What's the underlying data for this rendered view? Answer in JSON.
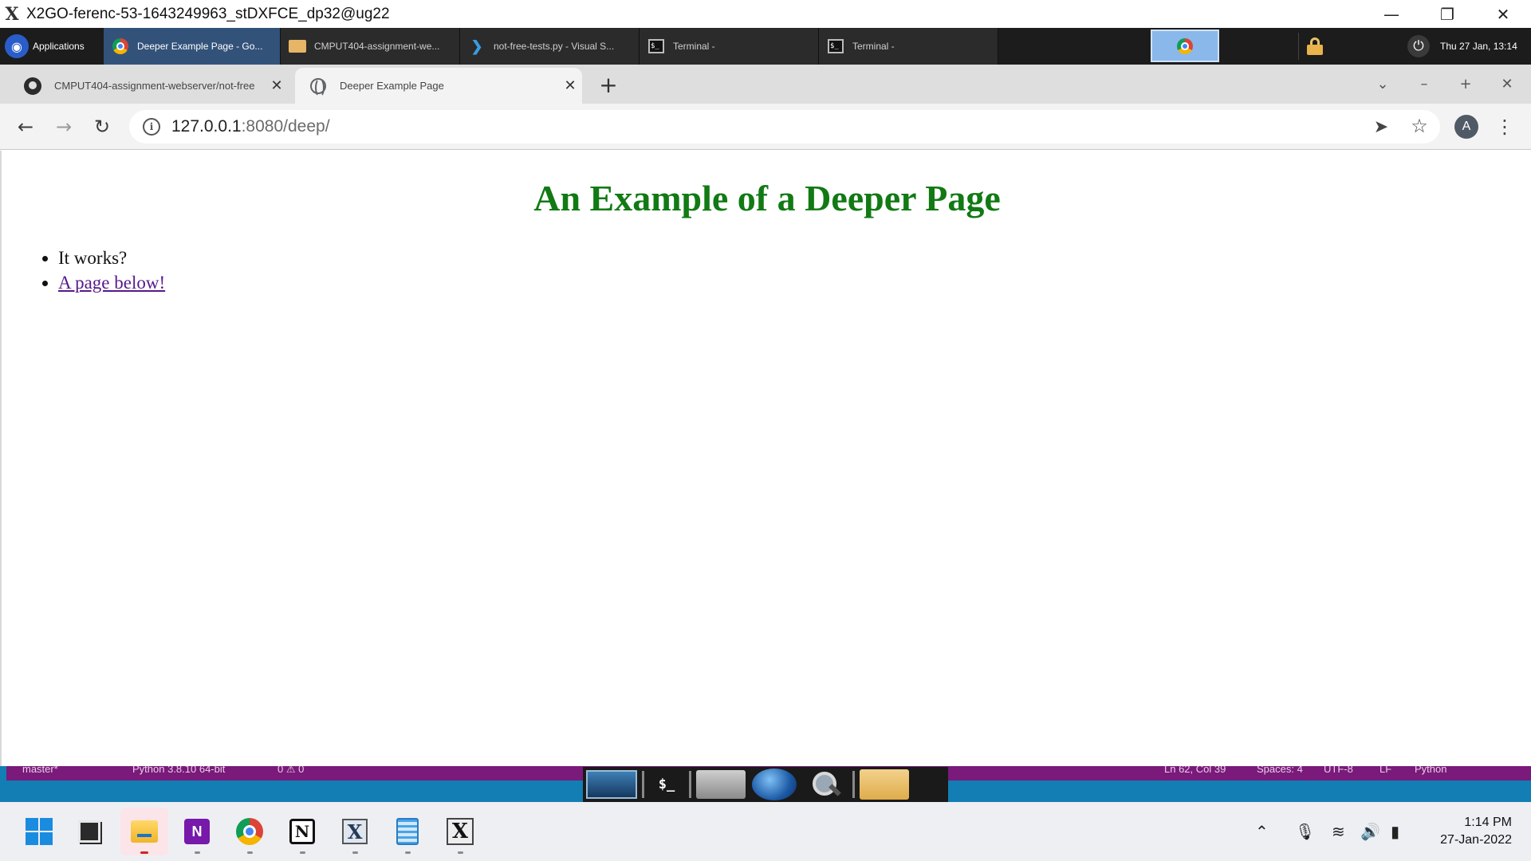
{
  "window": {
    "title": "X2GO-ferenc-53-1643249963_stDXFCE_dp32@ug22",
    "minimize_icon": "minimize-icon",
    "restore_icon": "restore-icon",
    "close_icon": "close-icon"
  },
  "xfce_panel": {
    "applications_label": "Applications",
    "tasks": [
      {
        "label": "Deeper Example Page - Go...",
        "icon": "chrome-icon",
        "active": true
      },
      {
        "label": "CMPUT404-assignment-we...",
        "icon": "folder-icon",
        "active": false
      },
      {
        "label": "not-free-tests.py - Visual S...",
        "icon": "vscode-icon",
        "active": false
      },
      {
        "label": "Terminal -",
        "icon": "terminal-icon",
        "active": false
      },
      {
        "label": "Terminal -",
        "icon": "terminal-icon",
        "active": false
      }
    ],
    "clock": "Thu 27 Jan, 13:14"
  },
  "browser": {
    "tabs": [
      {
        "label": "CMPUT404-assignment-webserver/not-free",
        "favicon": "github-icon",
        "active": false
      },
      {
        "label": "Deeper Example Page",
        "favicon": "globe-icon",
        "active": true
      }
    ],
    "address": {
      "host": "127.0.0.1",
      "path": ":8080/deep/"
    },
    "profile_initial": "A"
  },
  "page": {
    "heading": "An Example of a Deeper Page",
    "items": [
      {
        "text": "It works?",
        "link": false
      },
      {
        "text": "A page below!",
        "link": true
      }
    ],
    "heading_color": "#117a14",
    "visited_link_color": "#55198b"
  },
  "vscode_status": {
    "branch": "master*",
    "python": "Python 3.8.10 64-bit",
    "problems": "0 ⚠ 0",
    "cursor": "Ln 62, Col 39",
    "spaces": "Spaces: 4",
    "encoding": "UTF-8",
    "eol": "LF",
    "language": "Python"
  },
  "taskbar": {
    "apps": [
      "start-icon",
      "task-view-icon",
      "file-explorer-icon",
      "onenote-icon",
      "chrome-icon",
      "notion-icon",
      "x2go-icon",
      "notepad-icon",
      "x2go-session-icon"
    ],
    "time": "1:14 PM",
    "date": "27-Jan-2022"
  }
}
